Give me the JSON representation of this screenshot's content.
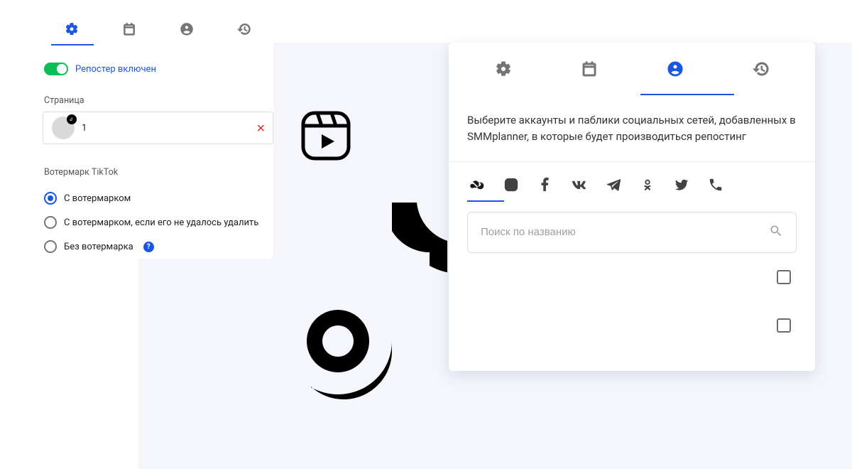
{
  "colors": {
    "accent": "#1a55e3",
    "success": "#0abf53",
    "danger": "#e53935"
  },
  "left_panel": {
    "tabs": [
      {
        "icon": "gear",
        "active": true
      },
      {
        "icon": "calendar",
        "active": false
      },
      {
        "icon": "person",
        "active": false
      },
      {
        "icon": "history",
        "active": false
      }
    ],
    "toggle": {
      "on": true,
      "label": "Репостер включен"
    },
    "page_section": {
      "title": "Страница",
      "item": {
        "label": "1",
        "badge_icon": "tiktok"
      }
    },
    "watermark_section": {
      "title": "Вотермарк TikTok",
      "options": [
        {
          "label": "С вотермарком",
          "checked": true,
          "help": false
        },
        {
          "label": "С вотермарком, если его не удалось удалить",
          "checked": false,
          "help": false
        },
        {
          "label": "Без вотермарка",
          "checked": false,
          "help": true
        }
      ]
    }
  },
  "right_panel": {
    "tabs": [
      {
        "icon": "gear",
        "active": false
      },
      {
        "icon": "calendar",
        "active": false
      },
      {
        "icon": "person",
        "active": true
      },
      {
        "icon": "history",
        "active": false
      }
    ],
    "description": "Выберите аккаунты и паблики социальных сетей, добавленных в SMMplanner, в которые будет производиться репостинг",
    "social_filters": [
      {
        "icon": "infinity",
        "active": true
      },
      {
        "icon": "instagram",
        "active": false
      },
      {
        "icon": "facebook",
        "active": false
      },
      {
        "icon": "vk",
        "active": false
      },
      {
        "icon": "telegram",
        "active": false
      },
      {
        "icon": "ok",
        "active": false
      },
      {
        "icon": "twitter",
        "active": false
      },
      {
        "icon": "viber",
        "active": false
      }
    ],
    "search": {
      "placeholder": "Поиск по названию"
    },
    "list_items": [
      {
        "checked": false
      },
      {
        "checked": false
      }
    ]
  }
}
